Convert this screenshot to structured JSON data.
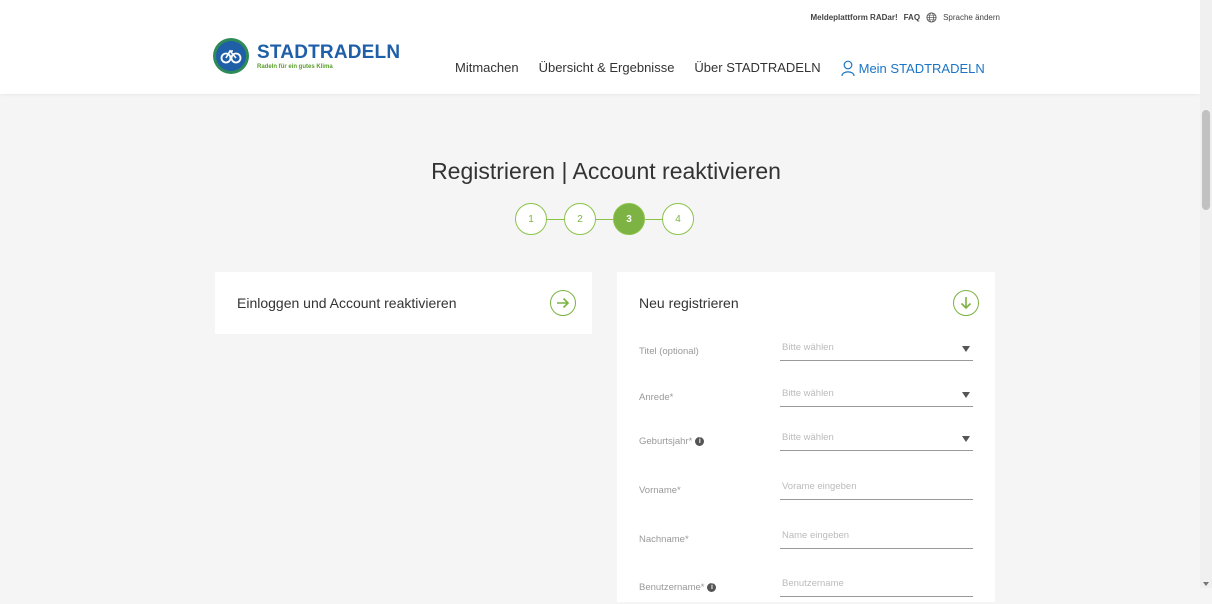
{
  "topbar": {
    "meldeplattform": "Meldeplattform RADar!",
    "faq": "FAQ",
    "language": "Sprache ändern"
  },
  "logo": {
    "title": "STADTRADELN",
    "subtitle": "Radeln für ein gutes Klima"
  },
  "nav": {
    "items": [
      {
        "label": "Mitmachen"
      },
      {
        "label": "Übersicht & Ergebnisse"
      },
      {
        "label": "Über STADTRADELN"
      }
    ],
    "account": "Mein STADTRADELN"
  },
  "page": {
    "title": "Registrieren | Account reaktivieren"
  },
  "stepper": {
    "steps": [
      "1",
      "2",
      "3",
      "4"
    ],
    "active_step": 3
  },
  "login_card": {
    "label": "Einloggen und Account reaktivieren",
    "icon": "arrow-right-circle-icon"
  },
  "register_card": {
    "label": "Neu registrieren",
    "icon": "arrow-down-circle-icon",
    "fields": [
      {
        "label": "Titel (optional)",
        "placeholder": "Bitte wählen",
        "type": "select",
        "info": false
      },
      {
        "label": "Anrede*",
        "placeholder": "Bitte wählen",
        "type": "select",
        "info": false
      },
      {
        "label": "Geburtsjahr*",
        "placeholder": "Bitte wählen",
        "type": "select",
        "info": true
      },
      {
        "label": "Vorname*",
        "placeholder": "Vorame eingeben",
        "type": "text",
        "info": false
      },
      {
        "label": "Nachname*",
        "placeholder": "Name eingeben",
        "type": "text",
        "info": false
      },
      {
        "label": "Benutzername*",
        "placeholder": "Benutzername",
        "type": "text",
        "info": true
      }
    ]
  },
  "colors": {
    "brand_blue": "#1f5fa8",
    "accent_green": "#7cb342",
    "link_blue": "#1a74c7",
    "background": "#f5f5f5"
  }
}
